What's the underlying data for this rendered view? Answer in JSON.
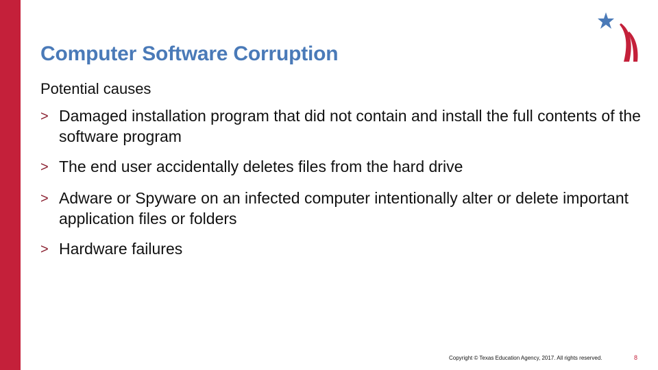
{
  "slide": {
    "title": "Computer Software Corruption",
    "subtitle": "Potential causes",
    "bullet_marker": ">",
    "bullets": [
      {
        "text": "Damaged installation program that did not contain and install the full contents of the software program"
      },
      {
        "text": "The end user accidentally deletes files from the hard drive"
      },
      {
        "text": "Adware or Spyware on an infected computer intentionally alter or delete important application files or folders"
      },
      {
        "text": "Hardware failures"
      }
    ]
  },
  "footer": {
    "copyright": "Copyright © Texas Education Agency, 2017. All rights reserved.",
    "page_number": "8"
  },
  "colors": {
    "accent_red": "#c4203a",
    "title_blue": "#4a7ab8",
    "star_blue": "#4a7ab8"
  },
  "logo": {
    "icon": "star-swoosh-logo"
  }
}
